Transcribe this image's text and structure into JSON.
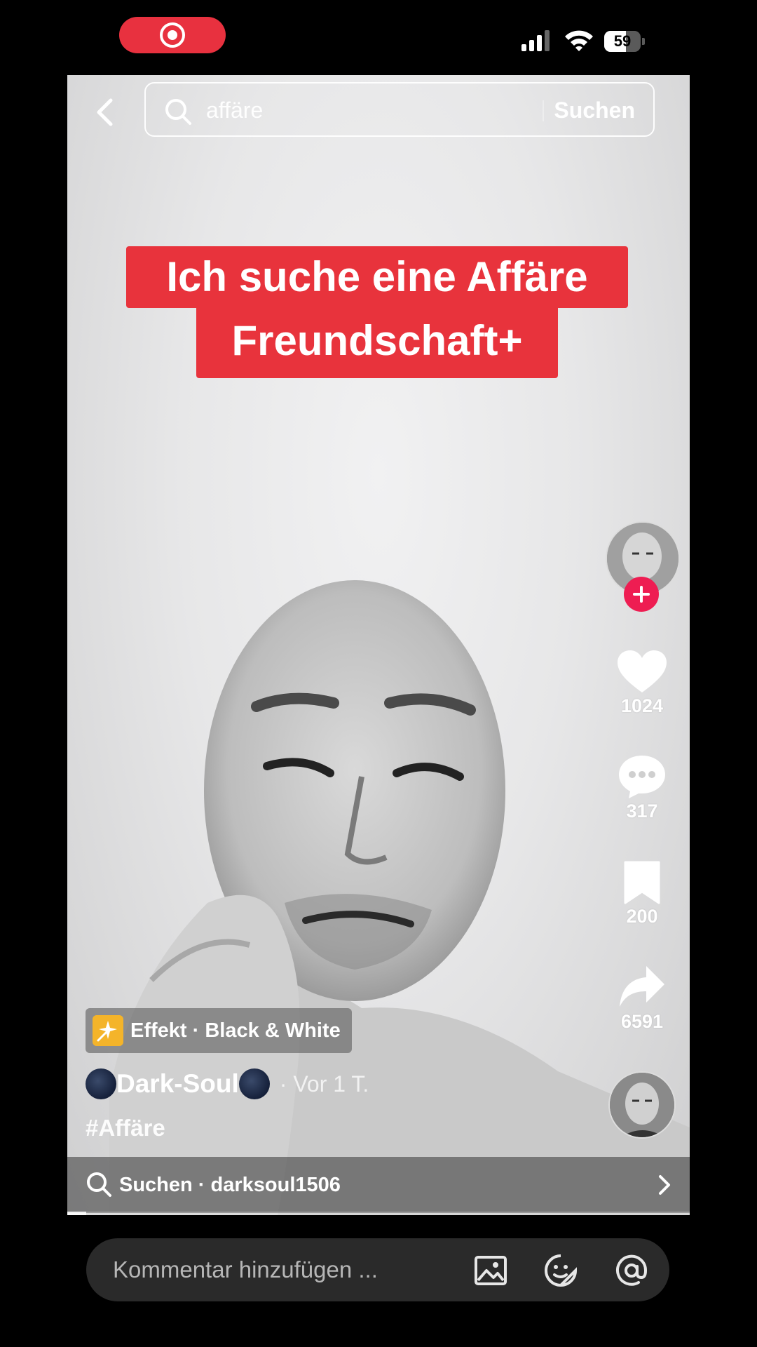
{
  "status_bar": {
    "battery": "59",
    "battery_level": 0.59
  },
  "search": {
    "query": "affäre",
    "submit_label": "Suchen"
  },
  "video": {
    "caption_line1": "Ich suche eine Affäre",
    "caption_line2": "Freundschaft+",
    "progress": 0.03
  },
  "actions": {
    "likes": "1024",
    "comments": "317",
    "saves": "200",
    "shares": "6591"
  },
  "info": {
    "effect_label": "Effekt · Black & White",
    "author": "Dark-Soul",
    "time": "· Vor 1 T.",
    "hashtag": "#Affäre"
  },
  "related_search": {
    "label": "Suchen · darksoul1506"
  },
  "comment_bar": {
    "placeholder": "Kommentar hinzufügen ..."
  },
  "icons": {
    "back": "chevron-left-icon",
    "search": "search-icon",
    "like": "heart-icon",
    "comment": "comment-bubble-icon",
    "save": "bookmark-icon",
    "share": "share-arrow-icon",
    "image": "image-icon",
    "emoji": "emoji-icon",
    "mention": "at-icon"
  },
  "colors": {
    "accent": "#e8333c",
    "follow": "#ee1d52",
    "effect": "#f4b42a",
    "recording": "#e8313f"
  }
}
